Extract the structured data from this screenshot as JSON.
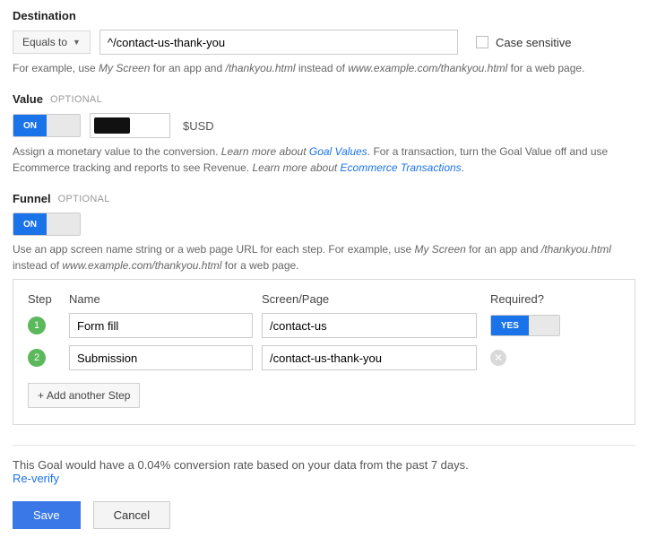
{
  "destination": {
    "title": "Destination",
    "match_label": "Equals to",
    "url_value": "^/contact-us-thank-you",
    "case_sensitive_label": "Case sensitive",
    "example_pre": "For example, use ",
    "example_i1": "My Screen",
    "example_mid1": " for an app and ",
    "example_i2": "/thankyou.html",
    "example_mid2": " instead of ",
    "example_i3": "www.example.com/thankyou.html",
    "example_post": " for a web page."
  },
  "value": {
    "title": "Value",
    "optional": "OPTIONAL",
    "toggle_state": "ON",
    "currency": "$USD",
    "help_a": "Assign a monetary value to the conversion. ",
    "help_i1": "Learn more about ",
    "link1": "Goal Values",
    "help_b": ". For a transaction, turn the Goal Value off and use Ecommerce tracking and reports to see Revenue. ",
    "help_i2": "Learn more about ",
    "link2": "Ecommerce Transactions",
    "dot": "."
  },
  "funnel": {
    "title": "Funnel",
    "optional": "OPTIONAL",
    "toggle_state": "ON",
    "help_pre": "Use an app screen name string or a web page URL for each step. For example, use ",
    "help_i1": "My Screen",
    "help_mid1": " for an app and ",
    "help_i2": "/thankyou.html",
    "help_mid2": " instead of ",
    "help_i3": "www.example.com/thankyou.html",
    "help_post": " for a web page.",
    "headers": {
      "step": "Step",
      "name": "Name",
      "page": "Screen/Page",
      "required": "Required?"
    },
    "rows": [
      {
        "num": "1",
        "name": "Form fill",
        "page": "/contact-us",
        "required_label": "YES"
      },
      {
        "num": "2",
        "name": "Submission",
        "page": "/contact-us-thank-you"
      }
    ],
    "add_label": "Add another Step"
  },
  "footer": {
    "msg": "This Goal would have a 0.04% conversion rate based on your data from the past 7 days.",
    "reverify": "Re-verify",
    "save": "Save",
    "cancel": "Cancel"
  }
}
